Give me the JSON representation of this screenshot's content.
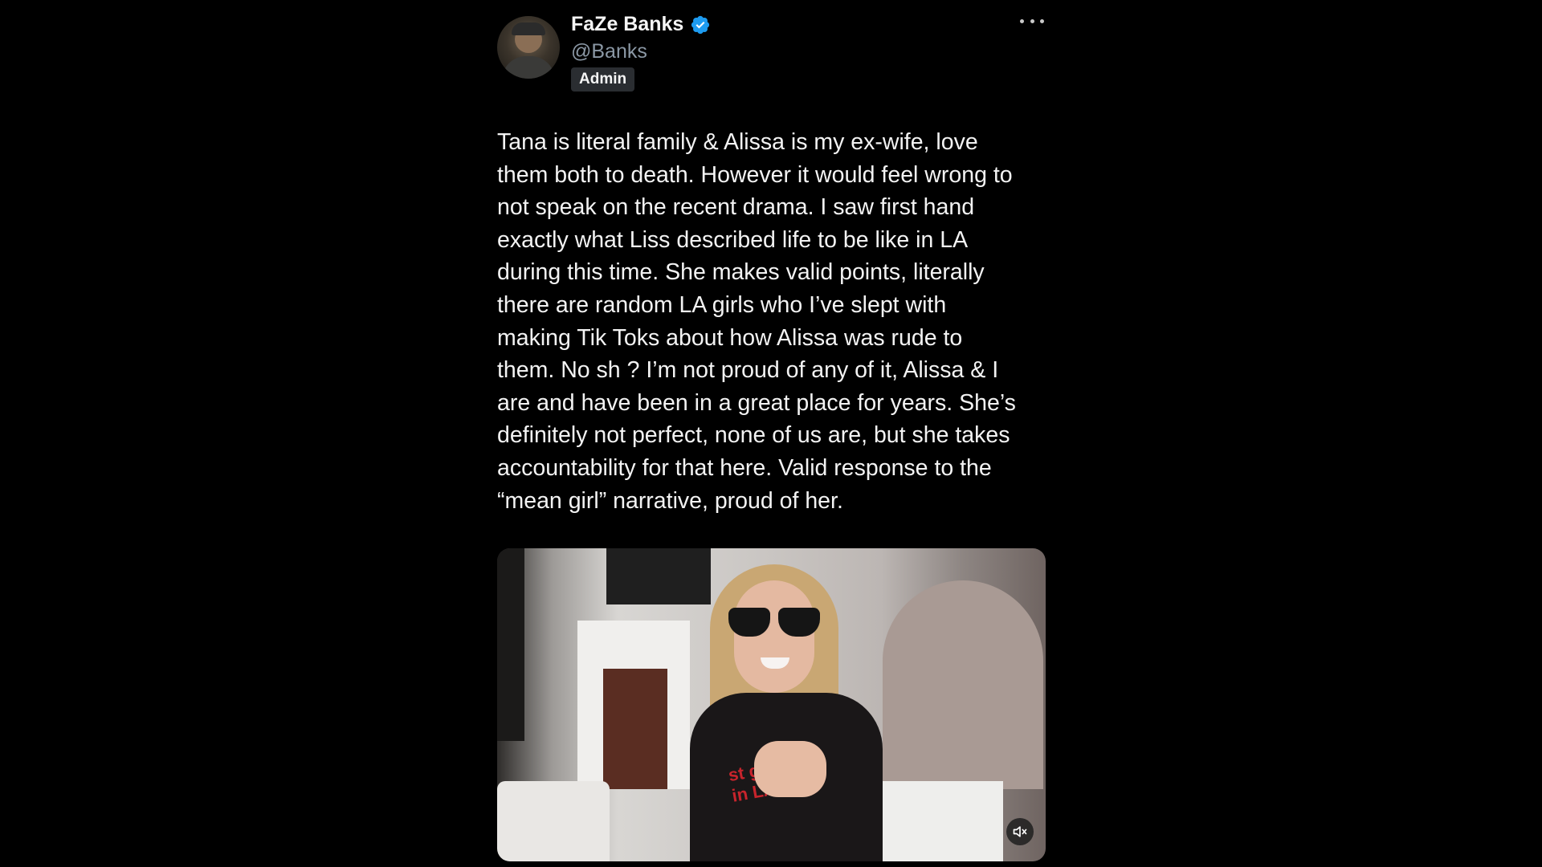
{
  "tweet": {
    "display_name": "FaZe Banks",
    "handle": "@Banks",
    "badge": "Admin",
    "text": "Tana is literal family & Alissa is my ex-wife, love\nthem both to death. However it would feel wrong to\nnot speak on the recent drama. I saw first hand\nexactly what Liss described life to be like in LA\nduring this time. She makes valid points, literally\nthere are random LA girls who I’ve slept with\nmaking Tik Toks about how Alissa was rude to\nthem. No sh   ? I’m not proud of any of it, Alissa & I\nare and have been in a great place for years. She’s\ndefinitely not perfect, none of us are, but she takes\naccountability for that here. Valid response to the\n“mean girl” narrative, proud of her.",
    "media": {
      "shirt_text": "st girl\nin LA"
    }
  },
  "icons": {
    "verified": "verified-badge-icon",
    "more": "more-options-icon",
    "mute": "mute-icon"
  },
  "colors": {
    "verified_blue": "#1d9bf0",
    "background": "#000000",
    "handle_gray": "#8b98a5"
  }
}
